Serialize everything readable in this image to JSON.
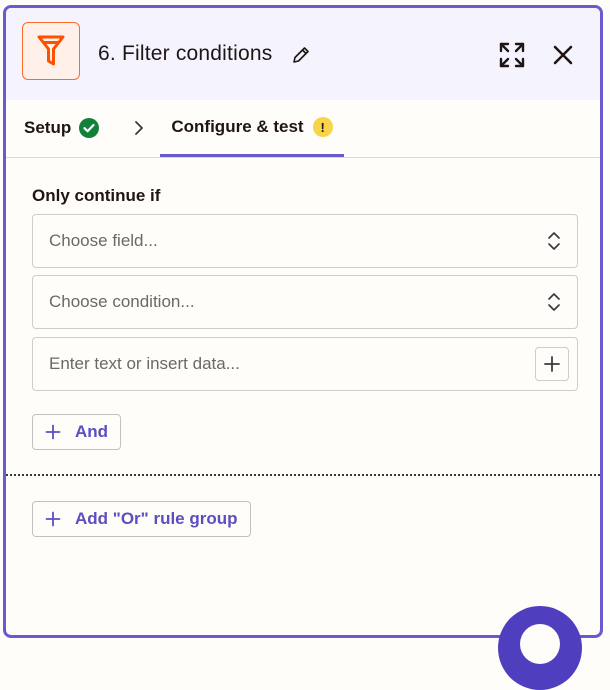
{
  "header": {
    "title": "6. Filter conditions"
  },
  "tabs": {
    "setup": "Setup",
    "configure": "Configure & test",
    "configure_badge": "!"
  },
  "form": {
    "section_label": "Only continue if",
    "field_placeholder": "Choose field...",
    "condition_placeholder": "Choose condition...",
    "value_placeholder": "Enter text or insert data..."
  },
  "buttons": {
    "and": "And",
    "or_group": "Add \"Or\" rule group"
  },
  "colors": {
    "accent": "#6a5ad0",
    "brand_orange": "#ff6a26",
    "success": "#13803a",
    "warning": "#f7d44a"
  },
  "icons": [
    "filter-app-icon",
    "pencil-icon",
    "expand-icon",
    "close-icon",
    "check-circle-icon",
    "chevron-right-icon",
    "warning-icon",
    "up-down-chevron-icon",
    "plus-icon"
  ]
}
